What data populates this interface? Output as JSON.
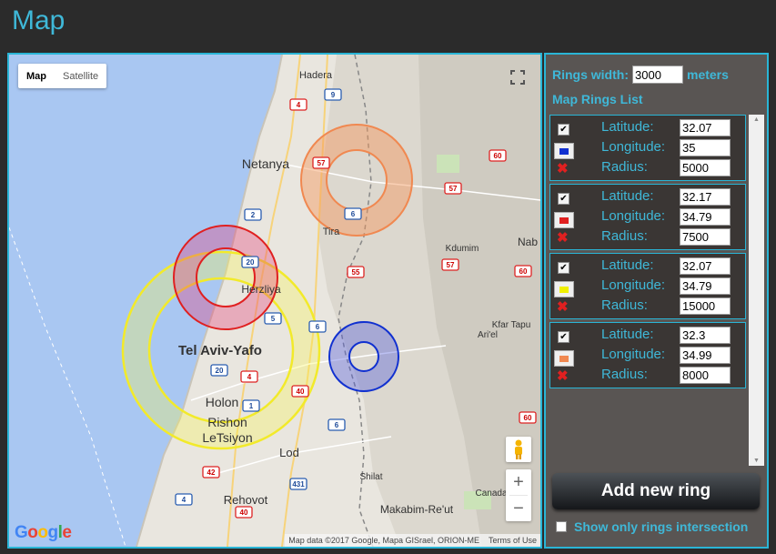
{
  "page": {
    "title": "Map"
  },
  "map": {
    "type_buttons": [
      "Map",
      "Satellite"
    ],
    "active_type": "Map",
    "cities": [
      "Hadera",
      "Netanya",
      "Tira",
      "Kdumim",
      "Nab",
      "Herzliya",
      "Tel Aviv-Yafo",
      "Kfar Tapu",
      "Ari'el",
      "Holon",
      "Rishon LeTsiyon",
      "Lod",
      "Shilat",
      "Rehovot",
      "Makabim-Re'ut",
      "Canada"
    ],
    "route_labels": [
      "4",
      "9",
      "57",
      "60",
      "57",
      "6",
      "2",
      "20",
      "55",
      "57",
      "60",
      "5",
      "6",
      "20",
      "4",
      "1",
      "40",
      "6",
      "60",
      "42",
      "431",
      "4",
      "40"
    ],
    "icons": [
      "fullscreen-icon",
      "pegman-icon",
      "zoom-in-icon",
      "zoom-out-icon"
    ],
    "zoom_in": "+",
    "zoom_out": "−",
    "google": "Google",
    "attribution": "Map data ©2017 Google, Mapa GISrael, ORION-ME",
    "terms": "Terms of Use"
  },
  "controls": {
    "rings_width_label": "Rings width:",
    "rings_width_value": "3000",
    "rings_width_unit": "meters",
    "list_title": "Map Rings List",
    "lat_label": "Latitude:",
    "lon_label": "Longitude:",
    "radius_label": "Radius:",
    "rings": [
      {
        "checked": true,
        "color": "#1030d0",
        "latitude": "32.07",
        "longitude": "35",
        "radius": "5000"
      },
      {
        "checked": true,
        "color": "#e02020",
        "latitude": "32.17",
        "longitude": "34.79",
        "radius": "7500"
      },
      {
        "checked": true,
        "color": "#f0f000",
        "latitude": "32.07",
        "longitude": "34.79",
        "radius": "15000"
      },
      {
        "checked": true,
        "color": "#f08850",
        "latitude": "32.3",
        "longitude": "34.99",
        "radius": "8000"
      }
    ],
    "add_button": "Add new ring",
    "show_intersection_label": "Show only rings intersection"
  }
}
